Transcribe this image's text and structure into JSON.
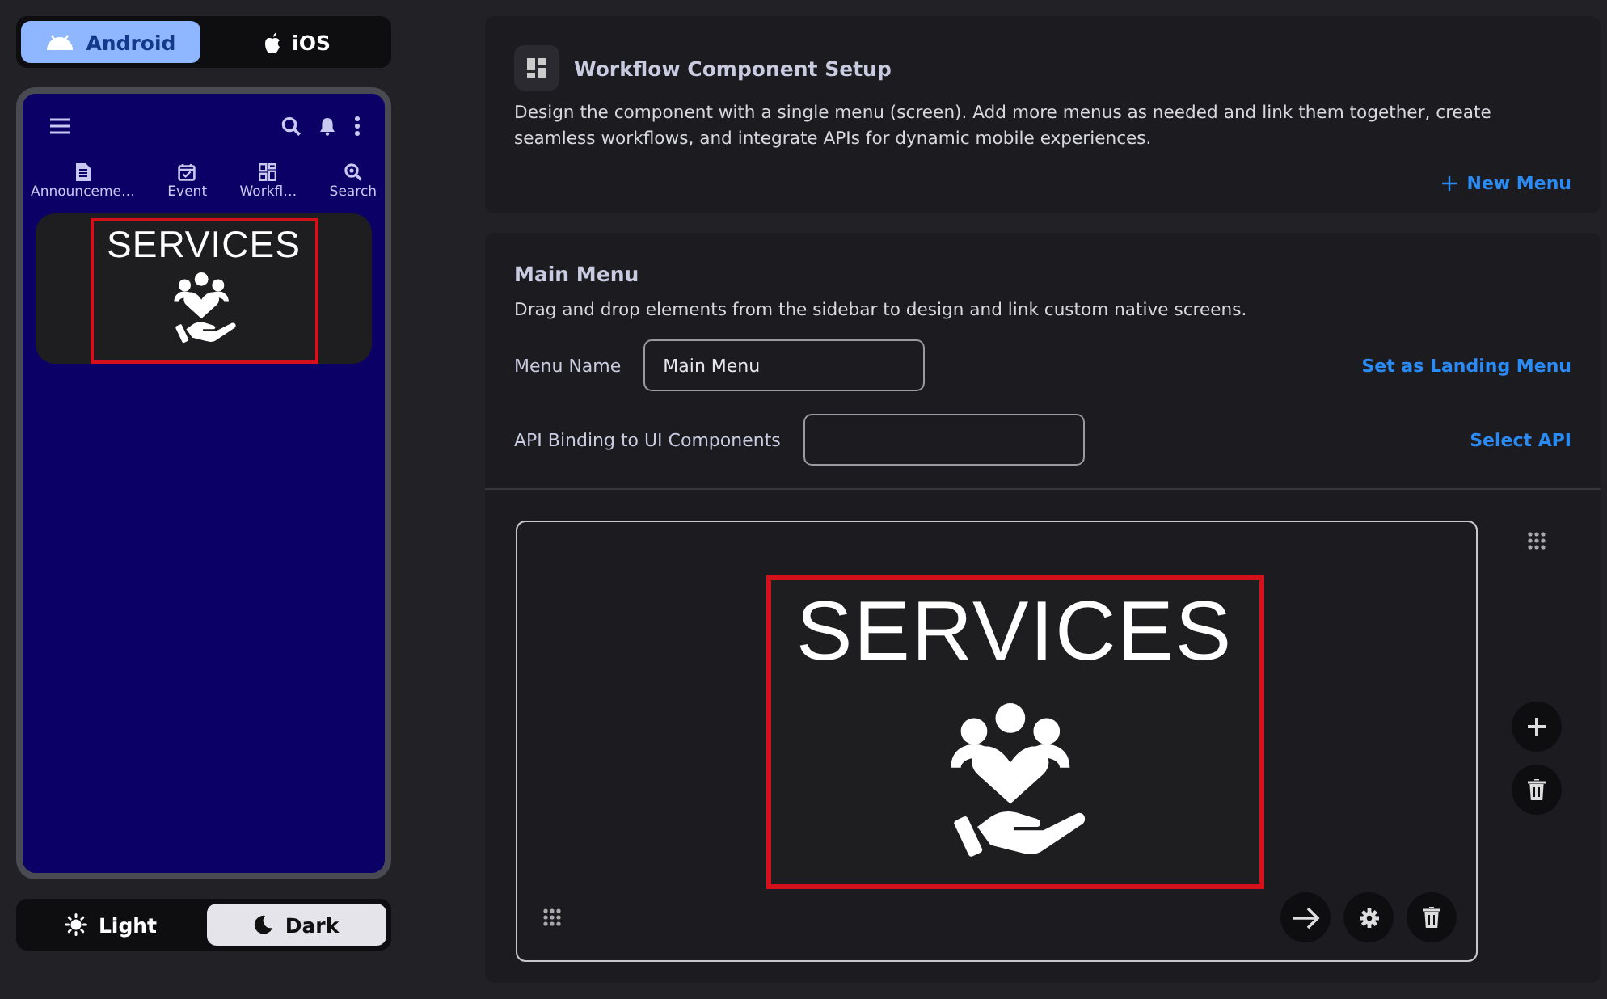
{
  "platform_toggle": [
    {
      "label": "Android",
      "selected": true
    },
    {
      "label": "iOS",
      "selected": false
    }
  ],
  "phone": {
    "tabs": [
      {
        "label": "Announceme…"
      },
      {
        "label": "Event"
      },
      {
        "label": "Workfl…"
      },
      {
        "label": "Search"
      }
    ],
    "banner_text": "SERVICES"
  },
  "theme_toggle": [
    {
      "label": "Light",
      "selected": false
    },
    {
      "label": "Dark",
      "selected": true
    }
  ],
  "setup": {
    "title": "Workflow Component Setup",
    "description": "Design the component with a single menu (screen). Add more menus as needed and link them together, create seamless workflows, and integrate APIs for dynamic mobile experiences.",
    "new_menu": "New Menu"
  },
  "main_menu": {
    "title": "Main Menu",
    "description": "Drag and drop elements from the sidebar to design and link custom native screens.",
    "fields": [
      {
        "label": "Menu Name",
        "value": "Main Menu",
        "action": "Set as Landing Menu"
      },
      {
        "label": "API Binding to UI Components",
        "action": "Select API"
      }
    ]
  },
  "preview": {
    "banner_text": "SERVICES"
  }
}
